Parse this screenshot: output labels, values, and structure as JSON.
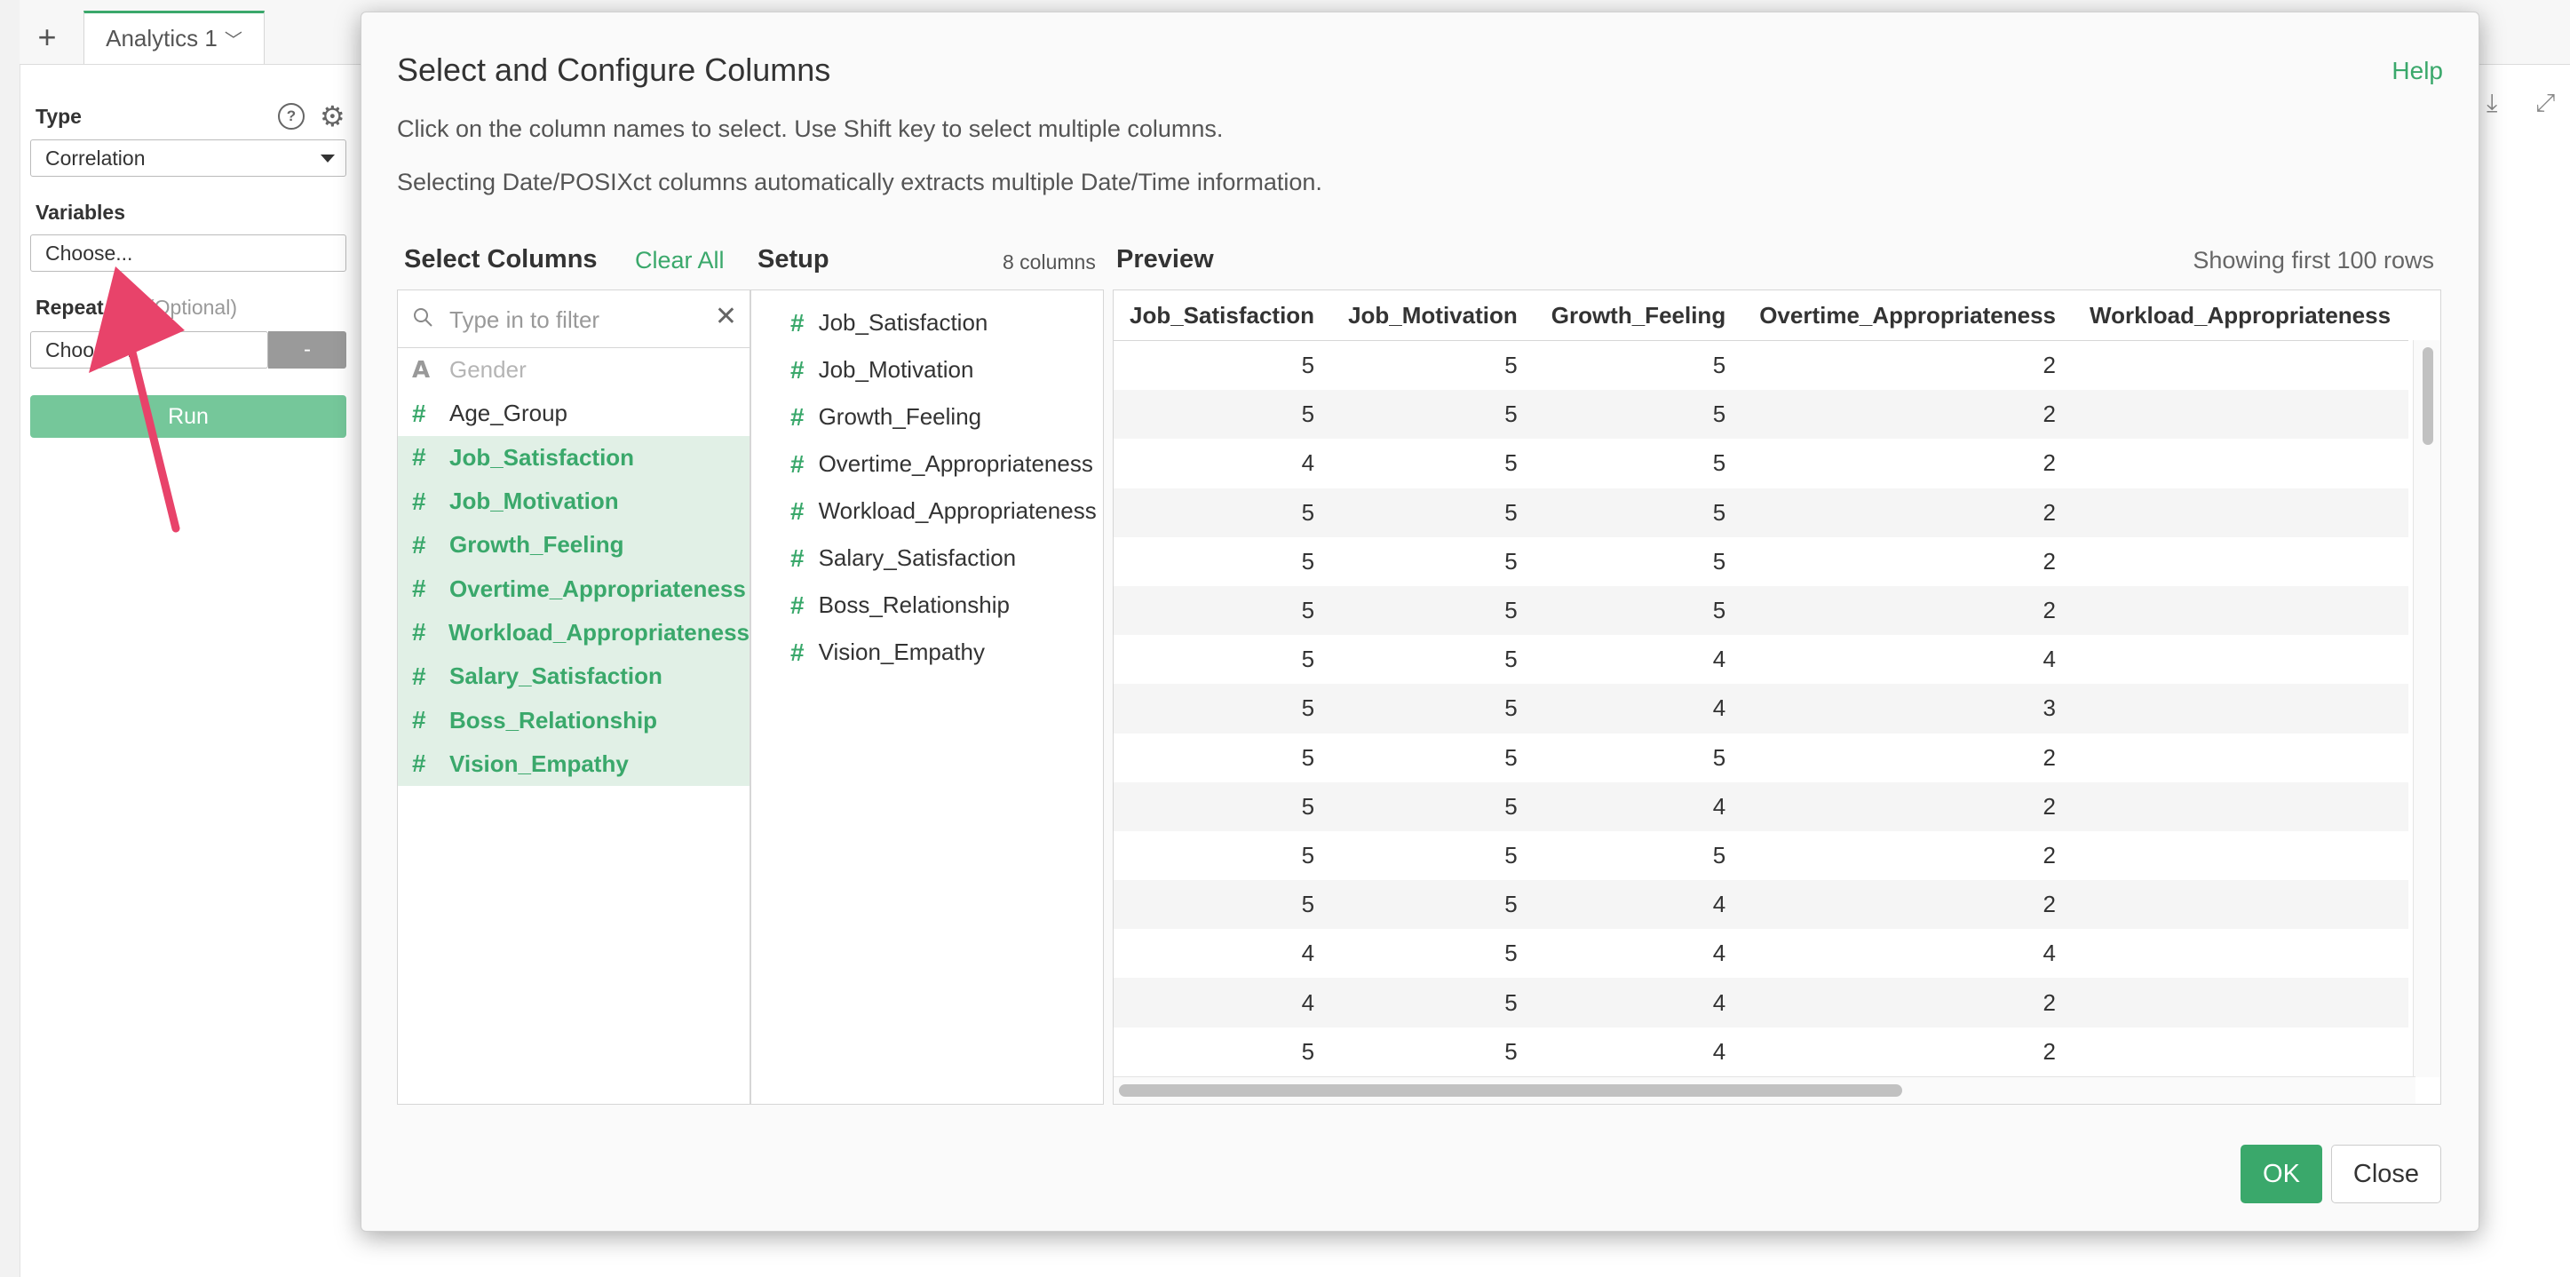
{
  "app": {
    "new_tab": "+",
    "tab_label": "Analytics 1",
    "tab_chevron": "﹀"
  },
  "sidebar": {
    "type_label": "Type",
    "type_value": "Correlation",
    "variables_label": "Variables",
    "variables_value": "Choose...",
    "repeat_label": "Repeat By",
    "repeat_optional": "(Optional)",
    "repeat_value": "Choose...",
    "repeat_button": "-",
    "run_label": "Run"
  },
  "dialog": {
    "title": "Select and Configure Columns",
    "help": "Help",
    "desc1": "Click on the column names to select. Use Shift key to select multiple columns.",
    "desc2": "Selecting Date/POSIXct columns automatically extracts multiple Date/Time information.",
    "select_columns_title": "Select Columns",
    "clear_all": "Clear All",
    "setup_title": "Setup",
    "column_count": "8 columns",
    "preview_title": "Preview",
    "showing": "Showing first 100 rows",
    "filter_placeholder": "Type in to filter",
    "ok": "OK",
    "close": "Close"
  },
  "columns": [
    {
      "type": "A",
      "name": "Gender",
      "state": "disabled"
    },
    {
      "type": "#",
      "name": "Age_Group",
      "state": "normal"
    },
    {
      "type": "#",
      "name": "Job_Satisfaction",
      "state": "selected"
    },
    {
      "type": "#",
      "name": "Job_Motivation",
      "state": "selected"
    },
    {
      "type": "#",
      "name": "Growth_Feeling",
      "state": "selected"
    },
    {
      "type": "#",
      "name": "Overtime_Appropriateness",
      "state": "selected"
    },
    {
      "type": "#",
      "name": "Workload_Appropriateness",
      "state": "selected"
    },
    {
      "type": "#",
      "name": "Salary_Satisfaction",
      "state": "selected"
    },
    {
      "type": "#",
      "name": "Boss_Relationship",
      "state": "selected"
    },
    {
      "type": "#",
      "name": "Vision_Empathy",
      "state": "selected"
    }
  ],
  "setup": [
    "Job_Satisfaction",
    "Job_Motivation",
    "Growth_Feeling",
    "Overtime_Appropriateness",
    "Workload_Appropriateness",
    "Salary_Satisfaction",
    "Boss_Relationship",
    "Vision_Empathy"
  ],
  "preview": {
    "headers": [
      "Job_Satisfaction",
      "Job_Motivation",
      "Growth_Feeling",
      "Overtime_Appropriateness",
      "Workload_Appropriateness"
    ],
    "rows": [
      [
        5,
        5,
        5,
        2,
        ""
      ],
      [
        5,
        5,
        5,
        2,
        ""
      ],
      [
        4,
        5,
        5,
        2,
        ""
      ],
      [
        5,
        5,
        5,
        2,
        ""
      ],
      [
        5,
        5,
        5,
        2,
        ""
      ],
      [
        5,
        5,
        5,
        2,
        ""
      ],
      [
        5,
        5,
        4,
        4,
        ""
      ],
      [
        5,
        5,
        4,
        3,
        ""
      ],
      [
        5,
        5,
        5,
        2,
        ""
      ],
      [
        5,
        5,
        4,
        2,
        ""
      ],
      [
        5,
        5,
        5,
        2,
        ""
      ],
      [
        5,
        5,
        4,
        2,
        ""
      ],
      [
        4,
        5,
        4,
        4,
        ""
      ],
      [
        4,
        5,
        4,
        2,
        ""
      ],
      [
        5,
        5,
        4,
        2,
        ""
      ]
    ]
  },
  "colors": {
    "accent": "#3aa86b",
    "selected_bg": "#e1f0e6",
    "annotation_arrow": "#e8436a"
  },
  "icons": {
    "help": "question-circle-icon",
    "settings": "gear-icon",
    "download": "download-icon",
    "expand": "expand-icon",
    "search": "search-icon",
    "clear": "close-icon",
    "dropdown": "caret-down-icon"
  }
}
